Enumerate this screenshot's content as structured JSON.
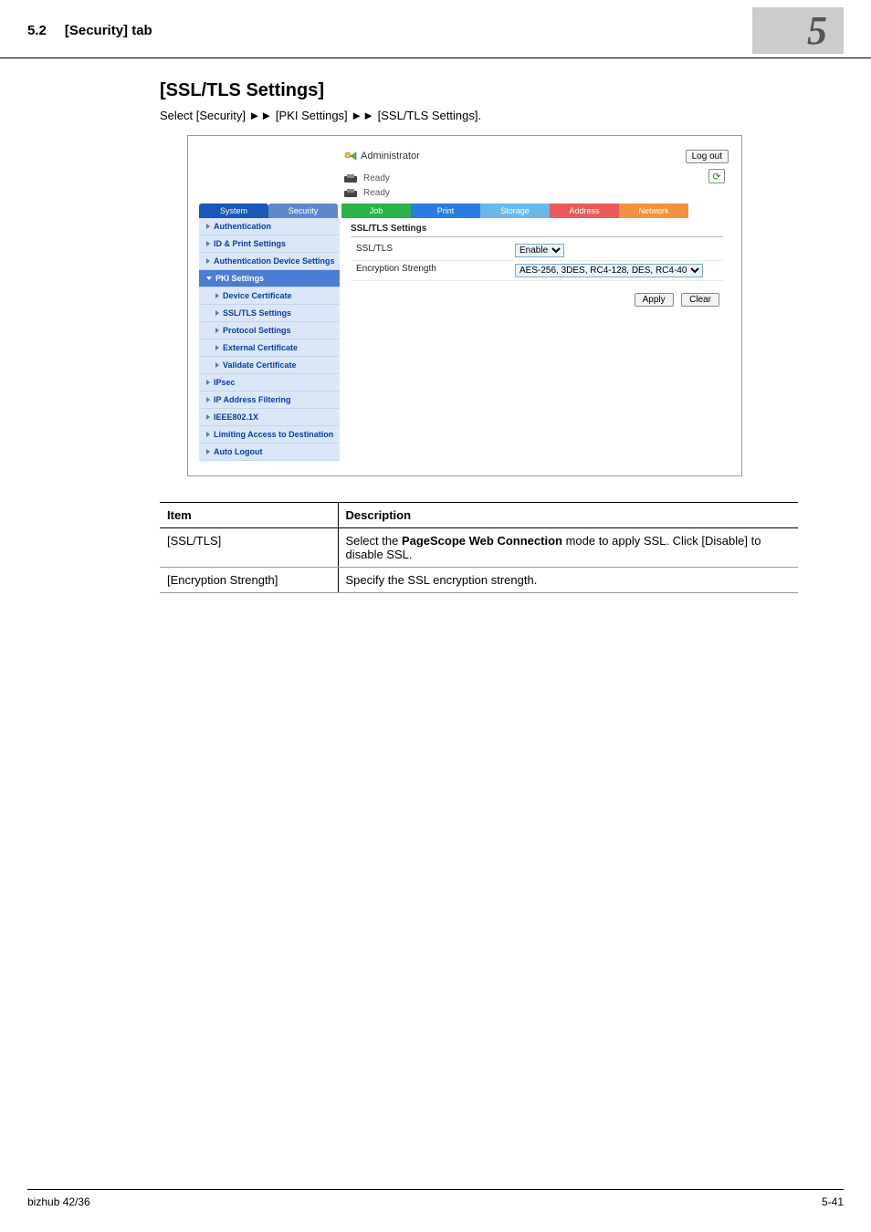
{
  "header": {
    "section_number": "5.2",
    "section_title": "[Security] tab",
    "chapter_number": "5"
  },
  "title": "[SSL/TLS Settings]",
  "intro_prefix": "Select [Security] ",
  "intro_mid1": " [PKI Settings] ",
  "intro_mid2": " [SSL/TLS Settings].",
  "shot": {
    "admin_label": "Administrator",
    "logout": "Log out",
    "ready1": "Ready",
    "ready2": "Ready",
    "tabs": {
      "system": "System",
      "security": "Security",
      "job": "Job",
      "print": "Print",
      "storage": "Storage",
      "address": "Address",
      "network": "Network"
    },
    "sidebar": {
      "authentication": "Authentication",
      "id_print": "ID & Print Settings",
      "auth_dev": "Authentication Device Settings",
      "pki": "PKI Settings",
      "device_cert": "Device Certificate",
      "ssl_tls": "SSL/TLS Settings",
      "protocol": "Protocol Settings",
      "external_cert": "External Certificate",
      "validate_cert": "Validate Certificate",
      "ipsec": "IPsec",
      "ipfilter": "IP Address Filtering",
      "ieee": "IEEE802.1X",
      "limiting": "Limiting Access to Destination",
      "auto_logout": "Auto Logout"
    },
    "panel": {
      "title": "SSL/TLS Settings",
      "row1_label": "SSL/TLS",
      "row1_val": "Enable",
      "row2_label": "Encryption Strength",
      "row2_val": "AES-256, 3DES, RC4-128, DES, RC4-40",
      "apply": "Apply",
      "clear": "Clear"
    }
  },
  "table": {
    "head_item": "Item",
    "head_desc": "Description",
    "r1_item": "[SSL/TLS]",
    "r1_desc_a": "Select the ",
    "r1_desc_b": "PageScope Web Connection",
    "r1_desc_c": " mode to apply SSL. Click [Disable] to disable SSL.",
    "r2_item": "[Encryption Strength]",
    "r2_desc": "Specify the SSL encryption strength."
  },
  "footer": {
    "product": "bizhub 42/36",
    "page": "5-41"
  }
}
